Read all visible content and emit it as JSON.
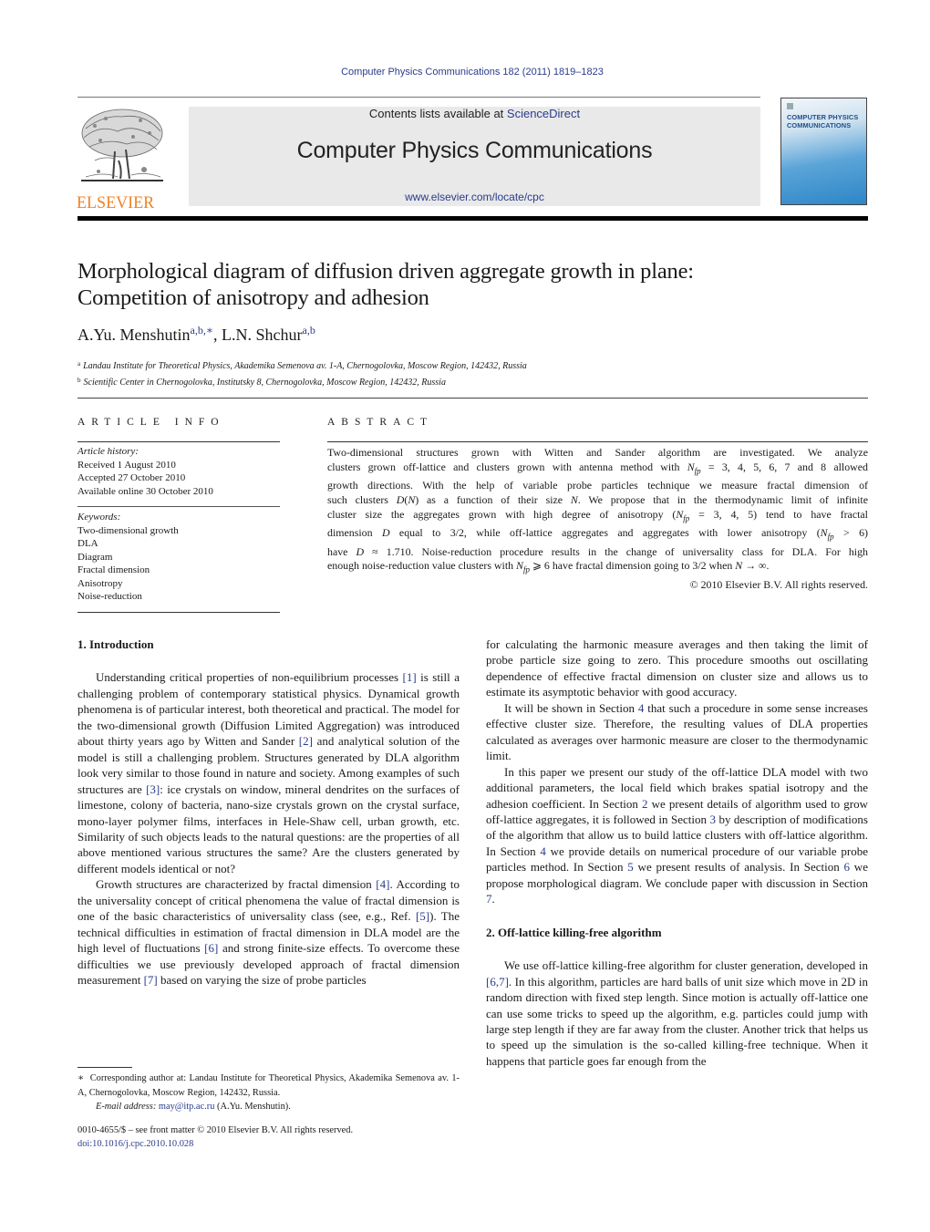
{
  "header": {
    "journal_ref": "Computer Physics Communications 182 (2011) 1819–1823",
    "contents_prefix": "Contents lists available at ",
    "contents_link": "ScienceDirect",
    "journal_title": "Computer Physics Communications",
    "journal_url": "www.elsevier.com/locate/cpc",
    "publisher_wordmark": "ELSEVIER",
    "cover_title_line1": "COMPUTER PHYSICS",
    "cover_title_line2": "COMMUNICATIONS"
  },
  "article": {
    "title_line1": "Morphological diagram of diffusion driven aggregate growth in plane:",
    "title_line2": "Competition of anisotropy and adhesion",
    "authors": [
      {
        "name": "A.Yu. Menshutin",
        "marks": "a,b,∗"
      },
      {
        "name": "L.N. Shchur",
        "marks": "a,b"
      }
    ],
    "author_separator": ", ",
    "affiliations": [
      {
        "mark": "a",
        "text": "Landau Institute for Theoretical Physics, Akademika Semenova av. 1-A, Chernogolovka, Moscow Region, 142432, Russia"
      },
      {
        "mark": "b",
        "text": "Scientific Center in Chernogolovka, Institutsky 8, Chernogolovka, Moscow Region, 142432, Russia"
      }
    ]
  },
  "article_info": {
    "heading": "ARTICLE INFO",
    "history_label": "Article history:",
    "history": [
      "Received 1 August 2010",
      "Accepted 27 October 2010",
      "Available online 30 October 2010"
    ],
    "keywords_label": "Keywords:",
    "keywords": [
      "Two-dimensional growth",
      "DLA",
      "Diagram",
      "Fractal dimension",
      "Anisotropy",
      "Noise-reduction"
    ]
  },
  "abstract": {
    "heading": "ABSTRACT",
    "lines": [
      "Two-dimensional structures grown with Witten and Sander algorithm are investigated. We analyze",
      "clusters grown off-lattice and clusters grown with antenna method with N_fp = 3, 4, 5, 6, 7 and 8 allowed",
      "growth directions. With the help of variable probe particles technique we measure fractal dimension of",
      "such clusters D(N) as a function of their size N. We propose that in the thermodynamic limit of infinite",
      "cluster size the aggregates grown with high degree of anisotropy (N_fp = 3, 4, 5) tend to have fractal",
      "dimension D equal to 3/2, while off-lattice aggregates and aggregates with lower anisotropy (N_fp > 6)",
      "have D ≈ 1.710. Noise-reduction procedure results in the change of universality class for DLA. For high",
      "enough noise-reduction value clusters with N_fp ⩾ 6 have fractal dimension going to 3/2 when N → ∞."
    ],
    "copyright": "© 2010 Elsevier B.V. All rights reserved."
  },
  "body": {
    "section1_heading": "1.  Introduction",
    "section1_p1": "Understanding critical properties of non-equilibrium processes [1] is still a challenging problem of contemporary statistical physics. Dynamical growth phenomena is of particular interest, both theoretical and practical. The model for the two-dimensional growth (Diffusion Limited Aggregation) was introduced about thirty years ago by Witten and Sander [2] and analytical solution of the model is still a challenging problem. Structures generated by DLA algorithm look very similar to those found in nature and society. Among examples of such structures are [3]: ice crystals on window, mineral dendrites on the surfaces of limestone, colony of bacteria, nano-size crystals grown on the crystal surface, mono-layer polymer films, interfaces in Hele-Shaw cell, urban growth, etc. Similarity of such objects leads to the natural questions: are the properties of all above mentioned various structures the same? Are the clusters generated by different models identical or not?",
    "section1_p2": "Growth structures are characterized by fractal dimension [4]. According to the universality concept of critical phenomena the value of fractal dimension is one of the basic characteristics of universality class (see, e.g., Ref. [5]). The technical difficulties in estimation of fractal dimension in DLA model are the high level of fluctuations [6] and strong finite-size effects. To overcome these difficulties we use previously developed approach of fractal dimension measurement [7] based on varying the size of probe particles",
    "section1_p2_cont": "for calculating the harmonic measure averages and then taking the limit of probe particle size going to zero. This procedure smooths out oscillating dependence of effective fractal dimension on cluster size and allows us to estimate its asymptotic behavior with good accuracy.",
    "section1_p3": "It will be shown in Section 4 that such a procedure in some sense increases effective cluster size. Therefore, the resulting values of DLA properties calculated as averages over harmonic measure are closer to the thermodynamic limit.",
    "section1_p4": "In this paper we present our study of the off-lattice DLA model with two additional parameters, the local field which brakes spatial isotropy and the adhesion coefficient. In Section 2 we present details of algorithm used to grow off-lattice aggregates, it is followed in Section 3 by description of modifications of the algorithm that allow us to build lattice clusters with off-lattice algorithm. In Section 4 we provide details on numerical procedure of our variable probe particles method. In Section 5 we present results of analysis. In Section 6 we propose morphological diagram. We conclude paper with discussion in Section 7.",
    "section2_heading": "2.  Off-lattice killing-free algorithm",
    "section2_p1": "We use off-lattice killing-free algorithm for cluster generation, developed in [6,7]. In this algorithm, particles are hard balls of unit size which move in 2D in random direction with fixed step length. Since motion is actually off-lattice one can use some tricks to speed up the algorithm, e.g. particles could jump with large step length if they are far away from the cluster. Another trick that helps us to speed up the simulation is the so-called killing-free technique. When it happens that particle goes far enough from the",
    "refs": {
      "r1": "[1]",
      "r2": "[2]",
      "r3": "[3]",
      "r4": "[4]",
      "r5": "[5]",
      "r6": "[6]",
      "r7": "[7]",
      "r67": "[6,7]"
    },
    "secrefs": {
      "s2": "2",
      "s3": "3",
      "s4": "4",
      "s5": "5",
      "s6": "6",
      "s7": "7"
    }
  },
  "footnote": {
    "mark": "∗",
    "text": "Corresponding author at: Landau Institute for Theoretical Physics, Akademika Semenova av. 1-A, Chernogolovka, Moscow Region, 142432, Russia.",
    "email_label": "E-mail address:",
    "email": "may@itp.ac.ru",
    "email_owner": "(A.Yu. Menshutin)."
  },
  "bottom": {
    "front_matter": "0010-4655/$ – see front matter  © 2010 Elsevier B.V. All rights reserved.",
    "doi": "doi:10.1016/j.cpc.2010.10.028"
  },
  "colors": {
    "link": "#2a3c8c",
    "elsevier_orange": "#f08223",
    "banner_bg": "#e9e9e9"
  }
}
